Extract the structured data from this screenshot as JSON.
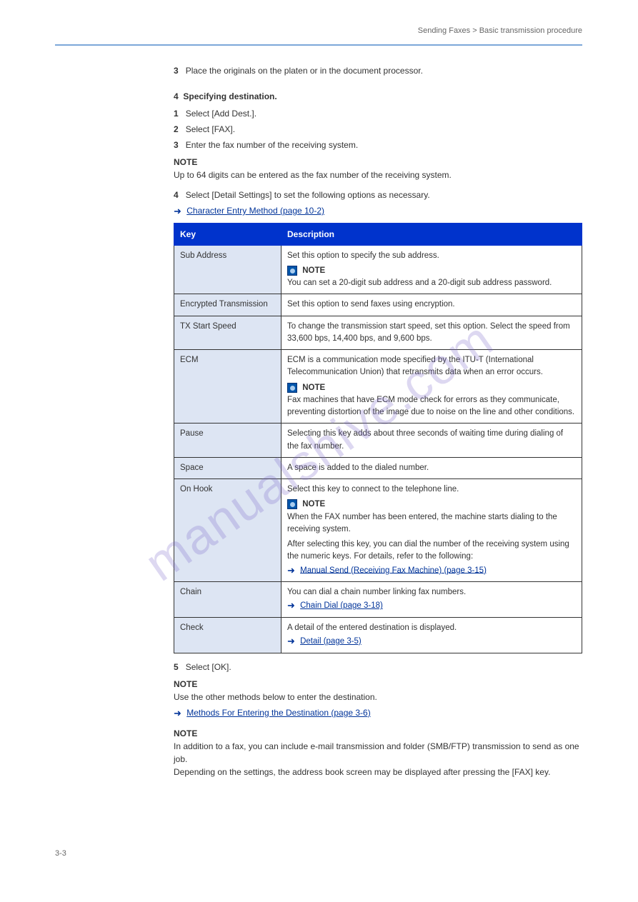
{
  "header_right": "Sending Faxes > Basic transmission procedure",
  "steps": {
    "s3": {
      "num": "3",
      "text": "Place the originals on the platen or in the document processor."
    },
    "s4": {
      "num": "4",
      "title": "Specifying destination.",
      "p1_num": "1",
      "p1_text": "Select [Add Dest.].",
      "p2_num": "2",
      "p2_text": "Select [FAX].",
      "p3_num": "3",
      "p3_text": "Enter the fax number of the receiving system.",
      "note_label": "NOTE",
      "note_text": "Up to 64 digits can be entered as the fax number of the receiving system.",
      "p4_num": "4",
      "p4_text": "Select [Detail Settings] to set the following options as necessary."
    },
    "link_top": "Character Entry Method (page 10-2)",
    "table": {
      "th1": "Key",
      "th2": "Description",
      "rows": [
        {
          "key": "Sub Address",
          "val_line1": "Set this option to specify the sub address.",
          "note_prefix": "NOTE",
          "note_body": "You can set a 20-digit sub address and a 20-digit sub address password."
        },
        {
          "key": "Encrypted Transmission",
          "val_line1": "Set this option to send faxes using encryption."
        },
        {
          "key": "TX Start Speed",
          "val_line1": "To change the transmission start speed, set this option. Select the speed from 33,600 bps, 14,400 bps, and 9,600 bps."
        },
        {
          "key": "ECM",
          "val_line1": "ECM is a communication mode specified by the ITU-T (International Telecommunication Union) that retransmits data when an error occurs.",
          "note_prefix": "NOTE",
          "note_body": "Fax machines that have ECM mode check for errors as they communicate, preventing distortion of the image due to noise on the line and other conditions."
        },
        {
          "key": "Pause",
          "val_line1": "Selecting this key adds about three seconds of waiting time during dialing of the fax number."
        },
        {
          "key": "Space",
          "val_line1": "A space is added to the dialed number."
        },
        {
          "key": "On Hook",
          "val_line1": "Select this key to connect to the telephone line.",
          "note_prefix": "NOTE",
          "note_body": "When the FAX number has been entered, the machine starts dialing to the receiving system.",
          "extra": "After selecting this key, you can dial the number of the receiving system using the numeric keys. For details, refer to the following:",
          "link": "Manual Send (Receiving Fax Machine) (page 3-15)"
        },
        {
          "key": "Chain",
          "val_line1": "You can dial a chain number linking fax numbers.",
          "link": "Chain Dial (page 3-18)"
        },
        {
          "key": "Check",
          "val_line1": "A detail of the entered destination is displayed.",
          "link": "Detail (page 3-5)"
        }
      ]
    },
    "s5": {
      "num": "5",
      "text": "Select [OK].",
      "note1_label": "NOTE",
      "note1_text": "Use the other methods below to enter the destination.",
      "link": "Methods For Entering the Destination (page 3-6)",
      "note2_label": "NOTE",
      "note2_line1": "In addition to a fax, you can include e-mail transmission and folder (SMB/FTP) transmission to send as one job.",
      "note2_line2": "Depending on the settings, the address book screen may be displayed after pressing the [FAX] key."
    }
  },
  "footer": "3-3",
  "watermark": "manualshive.com"
}
